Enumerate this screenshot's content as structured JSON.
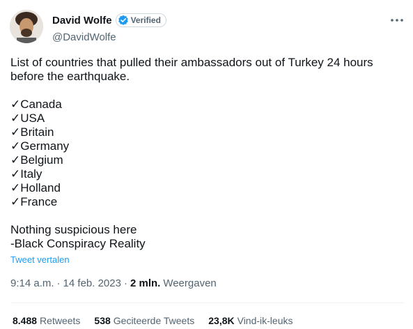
{
  "author": {
    "display_name": "David Wolfe",
    "handle": "@DavidWolfe",
    "verified_label": "Verified"
  },
  "tweet": {
    "intro": "List of countries that pulled their ambassadors out of Turkey 24 hours before the earthquake.",
    "countries": [
      "✓Canada",
      "✓USA",
      "✓Britain",
      "✓Germany",
      "✓Belgium",
      "✓Italy",
      "✓Holland",
      "✓France"
    ],
    "outro_1": "Nothing suspicious here",
    "outro_2": "-Black Conspiracy Reality",
    "translate_label": "Tweet vertalen"
  },
  "meta": {
    "time": "9:14 a.m.",
    "separator_1": "·",
    "date": "14 feb. 2023",
    "separator_2": "·",
    "views_count": "2 mln.",
    "views_label": "Weergaven"
  },
  "stats": {
    "retweets_count": "8.488",
    "retweets_label": "Retweets",
    "quotes_count": "538",
    "quotes_label": "Geciteerde Tweets",
    "likes_count": "23,8K",
    "likes_label": "Vind-ik-leuks"
  },
  "icons": {
    "more": "more-horizontal-icon",
    "verified": "verified-badge-icon"
  },
  "colors": {
    "link_blue": "#1d9bf0",
    "secondary_text": "#536471",
    "primary_text": "#0f1419"
  }
}
